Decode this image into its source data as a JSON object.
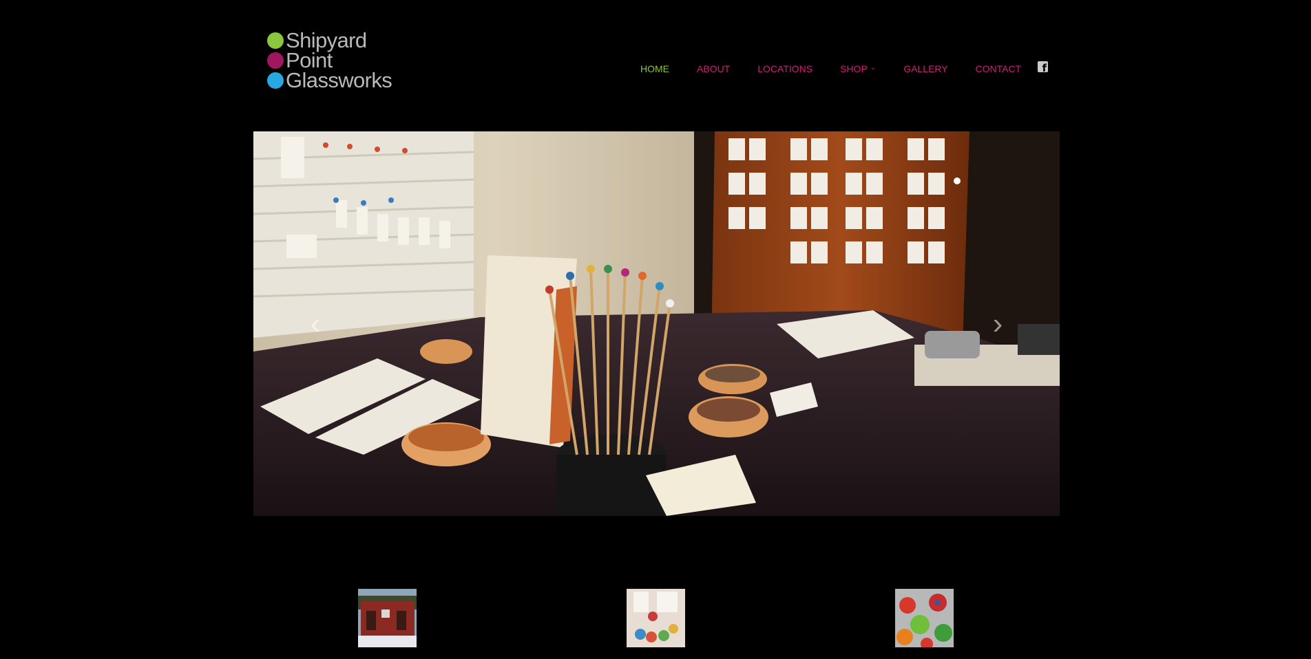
{
  "logo": {
    "lines": [
      {
        "word": "Shipyard",
        "dot_color": "#8cc63f"
      },
      {
        "word": "Point",
        "dot_color": "#a0165f"
      },
      {
        "word": "Glassworks",
        "dot_color": "#29a8e0"
      }
    ]
  },
  "nav": {
    "items": [
      {
        "label": "HOME",
        "color": "#8cc63f",
        "active": true
      },
      {
        "label": "ABOUT",
        "color": "#d41a7a"
      },
      {
        "label": "LOCATIONS",
        "color": "#d41a7a"
      },
      {
        "label": "SHOP",
        "color": "#d41a7a",
        "dropdown": true,
        "caret": "⌄"
      },
      {
        "label": "GALLERY",
        "color": "#d41a7a"
      },
      {
        "label": "CONTACT",
        "color": "#d41a7a"
      }
    ],
    "social_icon": "facebook-square-icon",
    "social_glyph": "f"
  },
  "slider": {
    "image": "craft-fair-booth-glass-beads-photo",
    "prev_glyph": "‹",
    "next_glyph": "›"
  },
  "thumbnails": [
    {
      "image": "red-studio-building-thumbnail"
    },
    {
      "image": "glass-bead-display-cards-thumbnail"
    },
    {
      "image": "colorful-glass-pendants-thumbnail"
    }
  ],
  "colors": {
    "background": "#000000",
    "nav_active": "#8cc63f",
    "nav_link": "#d41a7a"
  }
}
